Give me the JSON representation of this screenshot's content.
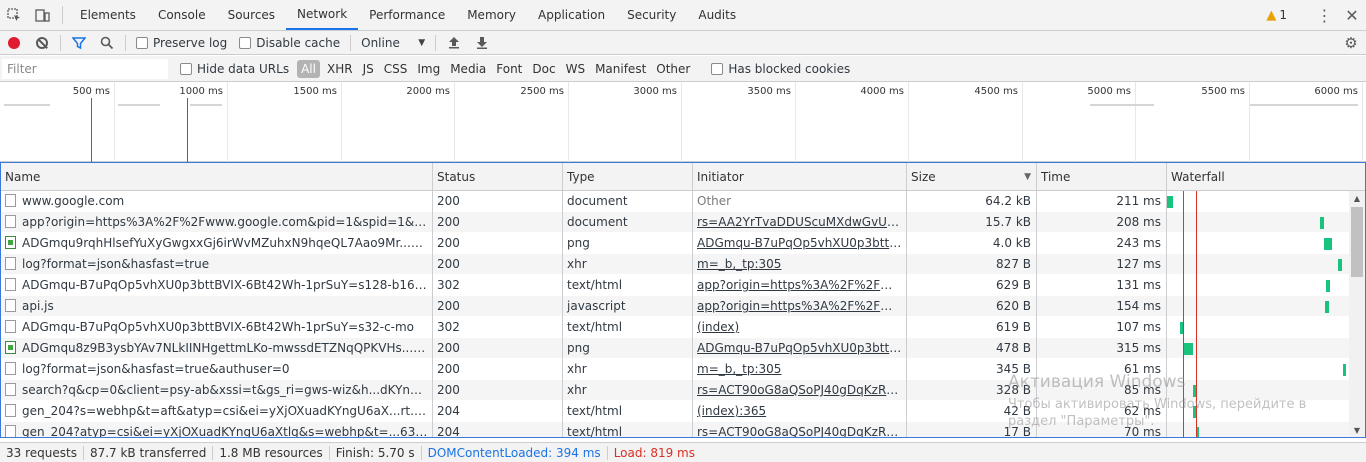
{
  "tabs": {
    "items": [
      "Elements",
      "Console",
      "Sources",
      "Network",
      "Performance",
      "Memory",
      "Application",
      "Security",
      "Audits"
    ],
    "active_index": 3,
    "warning_count": "1"
  },
  "toolbar": {
    "preserve_log": "Preserve log",
    "disable_cache": "Disable cache",
    "throttle": "Online"
  },
  "filterbar": {
    "placeholder": "Filter",
    "hide_data_urls": "Hide data URLs",
    "types": [
      "All",
      "XHR",
      "JS",
      "CSS",
      "Img",
      "Media",
      "Font",
      "Doc",
      "WS",
      "Manifest",
      "Other"
    ],
    "has_blocked_cookies": "Has blocked cookies"
  },
  "overview": {
    "labels": [
      "500 ms",
      "1000 ms",
      "1500 ms",
      "2000 ms",
      "2500 ms",
      "3000 ms",
      "3500 ms",
      "4000 ms",
      "4500 ms",
      "5000 ms",
      "5500 ms",
      "6000 ms"
    ]
  },
  "columns": {
    "name": "Name",
    "status": "Status",
    "type": "Type",
    "initiator": "Initiator",
    "size": "Size",
    "time": "Time",
    "waterfall": "Waterfall"
  },
  "rows": [
    {
      "name": "www.google.com",
      "status": "200",
      "type": "document",
      "initiator": "Other",
      "size": "64.2 kB",
      "time": "211 ms",
      "icon": "doc",
      "wf_start": 0.0,
      "wf_len": 0.035
    },
    {
      "name": "app?origin=https%3A%2F%2Fwww.google.com&pid=1&spid=1&hl=ru&g...",
      "status": "200",
      "type": "document",
      "initiator": "rs=AA2YrTvaDDUScuMXdwGvUGkB7...",
      "size": "15.7 kB",
      "time": "208 ms",
      "icon": "doc",
      "wf_start": 0.84,
      "wf_len": 0.02
    },
    {
      "name": "ADGmqu9rqhHlsefYuXyGwgxxGj6irWvMZuhxN9hqeQL7Aao9Mr...pCMHO...",
      "status": "200",
      "type": "png",
      "initiator": "ADGmqu-B7uPqOp5vhXU0p3bttBVIX...",
      "size": "4.0 kB",
      "time": "243 ms",
      "icon": "img",
      "wf_start": 0.86,
      "wf_len": 0.045
    },
    {
      "name": "log?format=json&hasfast=true",
      "status": "200",
      "type": "xhr",
      "initiator": "m=_b,_tp:305",
      "size": "827 B",
      "time": "127 ms",
      "icon": "doc",
      "wf_start": 0.94,
      "wf_len": 0.02
    },
    {
      "name": "ADGmqu-B7uPqOp5vhXU0p3bttBVIX-6Bt42Wh-1prSuY=s128-b16-cc-rp-mo",
      "status": "302",
      "type": "text/html",
      "initiator": "app?origin=https%3A%2F%2Fwww.g...",
      "size": "629 B",
      "time": "131 ms",
      "icon": "doc",
      "wf_start": 0.875,
      "wf_len": 0.02
    },
    {
      "name": "api.js",
      "status": "200",
      "type": "javascript",
      "initiator": "app?origin=https%3A%2F%2Fwww.g...",
      "size": "620 B",
      "time": "154 ms",
      "icon": "doc",
      "wf_start": 0.87,
      "wf_len": 0.02
    },
    {
      "name": "ADGmqu-B7uPqOp5vhXU0p3bttBVIX-6Bt42Wh-1prSuY=s32-c-mo",
      "status": "302",
      "type": "text/html",
      "initiator": "(index)",
      "size": "619 B",
      "time": "107 ms",
      "icon": "doc",
      "wf_start": 0.07,
      "wf_len": 0.02
    },
    {
      "name": "ADGmqu8z9B3ysbYAv7NLkIINHgettmLKo-mwssdETZNqQPKVHs...1P36Xo...",
      "status": "200",
      "type": "png",
      "initiator": "ADGmqu-B7uPqOp5vhXU0p3bttBVIX...",
      "size": "478 B",
      "time": "315 ms",
      "icon": "img",
      "wf_start": 0.09,
      "wf_len": 0.055
    },
    {
      "name": "log?format=json&hasfast=true&authuser=0",
      "status": "200",
      "type": "xhr",
      "initiator": "m=_b,_tp:305",
      "size": "345 B",
      "time": "61 ms",
      "icon": "doc",
      "wf_start": 0.965,
      "wf_len": 0.01
    },
    {
      "name": "search?q&cp=0&client=psy-ab&xssi=t&gs_ri=gws-wiz&h...dKYngU6aXtlg...",
      "status": "200",
      "type": "xhr",
      "initiator": "rs=ACT90oG8aQSoPJ40gDqKzRKkjB...",
      "size": "328 B",
      "time": "85 ms",
      "icon": "doc",
      "wf_start": 0.145,
      "wf_len": 0.015
    },
    {
      "name": "gen_204?s=webhp&t=aft&atyp=csi&ei=yXjOXuadKYngU6aX...rt.161,aft.15...",
      "status": "204",
      "type": "text/html",
      "initiator": "(index):365",
      "size": "42 B",
      "time": "62 ms",
      "icon": "doc",
      "wf_start": 0.145,
      "wf_len": 0.01
    },
    {
      "name": "gen_204?atyp=csi&ei=yXjOXuadKYngU6aXtlg&s=webhp&t=...63,rqstt.26,...",
      "status": "204",
      "type": "text/html",
      "initiator": "rs=ACT90oG8aQSoPJ40gDqKzRKkjB...",
      "size": "17 B",
      "time": "70 ms",
      "icon": "doc",
      "wf_start": 0.16,
      "wf_len": 0.012
    }
  ],
  "statusbar": {
    "requests": "33 requests",
    "transferred": "87.7 kB transferred",
    "resources": "1.8 MB resources",
    "finish": "Finish: 5.70 s",
    "dom_loaded": "DOMContentLoaded: 394 ms",
    "load": "Load: 819 ms"
  },
  "watermark": {
    "title": "Активация Windows",
    "text": "Чтобы активировать Windows, перейдите в раздел \"Параметры\"."
  },
  "colors": {
    "dom_line": "#1a73e8",
    "load_line": "#d93025",
    "accent": "#1a73e8"
  }
}
